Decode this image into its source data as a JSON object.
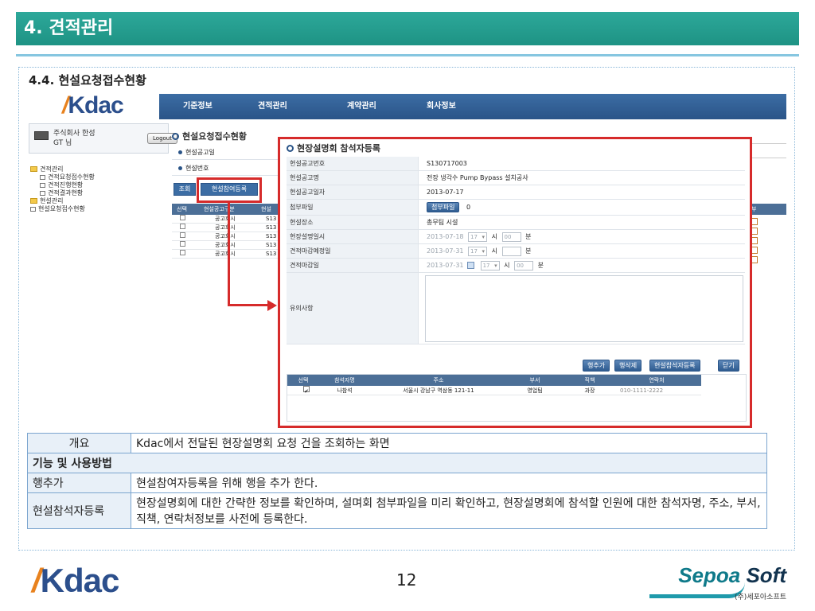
{
  "slide": {
    "title": "4. 견적관리",
    "section_title": "4.4. 현설요청접수현황",
    "page_number": "12"
  },
  "app": {
    "logo_prefix": "K",
    "logo_text": "dac",
    "nav": [
      "기준정보",
      "견적관리",
      "계약관리",
      "회사정보"
    ],
    "user": {
      "company": "주식회사 한성",
      "name": "GT 님",
      "logout_label": "Logout"
    },
    "tree": [
      {
        "label": "견적관리",
        "type": "folder"
      },
      {
        "label": "견적요청접수현황",
        "type": "item"
      },
      {
        "label": "견적진행현황",
        "type": "item"
      },
      {
        "label": "견적결과현황",
        "type": "item"
      },
      {
        "label": "현설관리",
        "type": "folder"
      },
      {
        "label": "현설요청접수현황",
        "type": "item"
      }
    ],
    "background": {
      "panel_title": "현설요청접수현황",
      "fields": [
        "현설공고일",
        "현설번호"
      ],
      "buttons": [
        "조회",
        "현설참여등록"
      ],
      "columns": [
        "선택",
        "현설공고구분",
        "현설"
      ],
      "rows": [
        {
          "type": "공고회시",
          "no": "S13"
        },
        {
          "type": "공고회시",
          "no": "S13"
        },
        {
          "type": "공고회시",
          "no": "S13"
        },
        {
          "type": "공고회시",
          "no": "S13"
        },
        {
          "type": "공고회시",
          "no": "S13"
        }
      ],
      "right_col_header": "부"
    },
    "popup": {
      "title": "현장설명회 참석자등록",
      "fields": {
        "notice_no": {
          "label": "현설공고번호",
          "value": "S130717003"
        },
        "notice_name": {
          "label": "현설공고명",
          "value": "전장 냉각수 Pump Bypass 설치공사"
        },
        "notice_date": {
          "label": "현설공고일자",
          "value": "2013-07-17"
        },
        "attachment": {
          "label": "첨부파일",
          "button": "첨부파일",
          "count": "0"
        },
        "place": {
          "label": "현설장소",
          "value": "총무팀 시설"
        },
        "datetime": {
          "label": "현장설명일시",
          "date": "2013-07-18",
          "hour": "17",
          "hour_unit": "시",
          "minute": "00",
          "minute_unit": "분"
        },
        "est_due": {
          "label": "견적마감예정일",
          "date": "2013-07-31",
          "hour": "17",
          "hour_unit": "시",
          "minute": "",
          "minute_unit": "분"
        },
        "est_close": {
          "label": "견적마감일",
          "date": "2013-07-31",
          "hour": "17",
          "hour_unit": "시",
          "minute": "00",
          "minute_unit": "분"
        },
        "notes": {
          "label": "유의사항",
          "value": ""
        }
      },
      "actions": [
        "행추가",
        "행삭제",
        "현설참석자등록",
        "닫기"
      ],
      "grid": {
        "columns": [
          "선택",
          "참석자명",
          "주소",
          "부서",
          "직책",
          "연락처"
        ],
        "rows": [
          {
            "checked": "✔",
            "name": "나참석",
            "address": "서울시 강남구 역삼동 121-11",
            "dept": "영업팀",
            "position": "과장",
            "phone": "010-1111-2222"
          }
        ]
      }
    }
  },
  "description": {
    "overview_label": "개요",
    "overview_text": "Kdac에서 전달된 현장설명회 요청 건을 조회하는 화면",
    "section_label": "기능 및 사용방법",
    "rows": [
      {
        "label": "행추가",
        "text": "현설참여자등록을 위해 행을 추가 한다."
      },
      {
        "label": "현설참석자등록",
        "text": "현장설명회에 대한 간략한 정보를 확인하며, 설며회 첨부파일을 미리 확인하고, 현장설명회에 참석할 인원에 대한 참석자명, 주소, 부서, 직책, 연락처정보를 사전에 등록한다."
      }
    ]
  },
  "footer": {
    "brand": "Sepoa",
    "brand_suffix": "Soft",
    "brand_sub": "(주)세포아소프트"
  },
  "colors": {
    "title_bar": "#1e9384",
    "nav_bar": "#2a5488",
    "highlight": "#d62b2b",
    "grid_header": "#4c6f97"
  }
}
